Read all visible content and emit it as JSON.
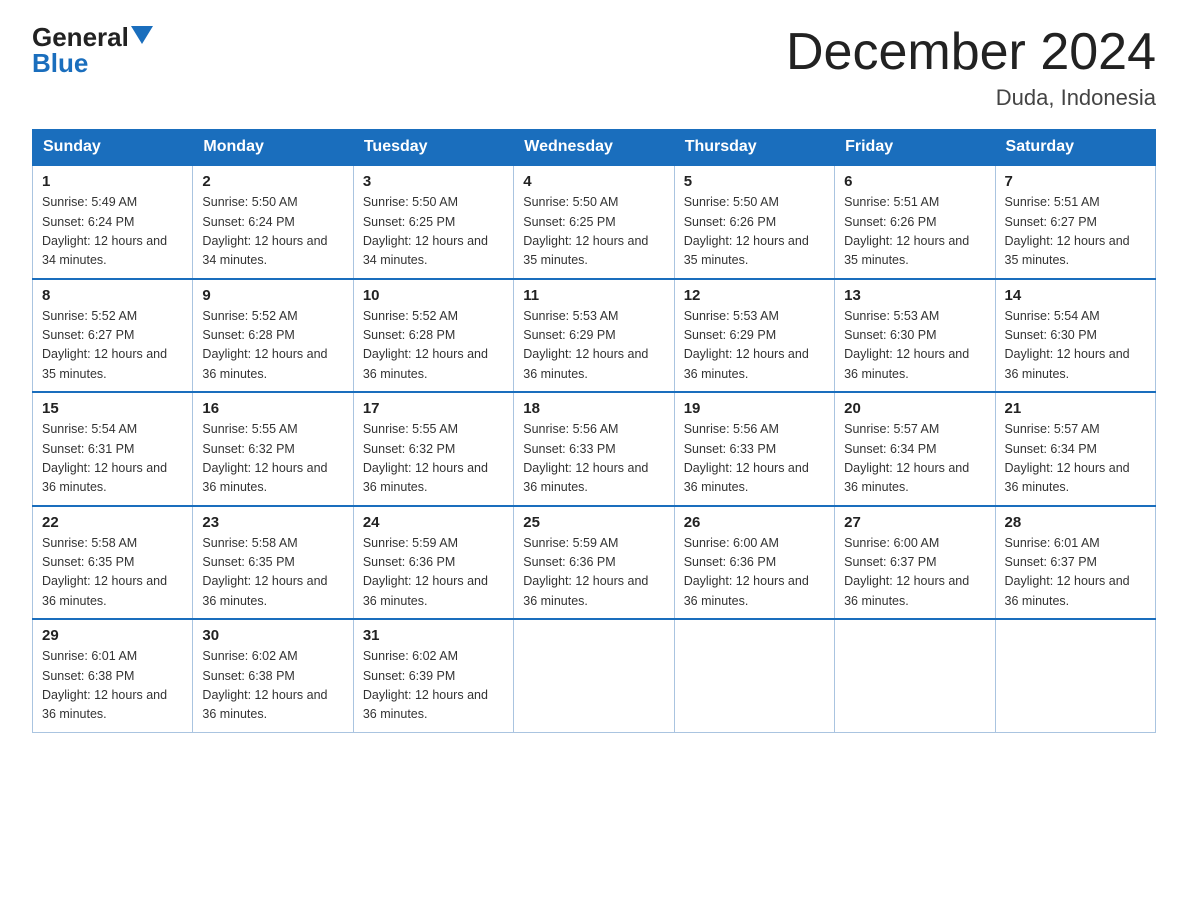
{
  "logo": {
    "general": "General",
    "blue": "Blue",
    "triangle": "▼"
  },
  "title": "December 2024",
  "subtitle": "Duda, Indonesia",
  "days_of_week": [
    "Sunday",
    "Monday",
    "Tuesday",
    "Wednesday",
    "Thursday",
    "Friday",
    "Saturday"
  ],
  "weeks": [
    [
      {
        "day": "1",
        "sunrise": "5:49 AM",
        "sunset": "6:24 PM",
        "daylight": "12 hours and 34 minutes."
      },
      {
        "day": "2",
        "sunrise": "5:50 AM",
        "sunset": "6:24 PM",
        "daylight": "12 hours and 34 minutes."
      },
      {
        "day": "3",
        "sunrise": "5:50 AM",
        "sunset": "6:25 PM",
        "daylight": "12 hours and 34 minutes."
      },
      {
        "day": "4",
        "sunrise": "5:50 AM",
        "sunset": "6:25 PM",
        "daylight": "12 hours and 35 minutes."
      },
      {
        "day": "5",
        "sunrise": "5:50 AM",
        "sunset": "6:26 PM",
        "daylight": "12 hours and 35 minutes."
      },
      {
        "day": "6",
        "sunrise": "5:51 AM",
        "sunset": "6:26 PM",
        "daylight": "12 hours and 35 minutes."
      },
      {
        "day": "7",
        "sunrise": "5:51 AM",
        "sunset": "6:27 PM",
        "daylight": "12 hours and 35 minutes."
      }
    ],
    [
      {
        "day": "8",
        "sunrise": "5:52 AM",
        "sunset": "6:27 PM",
        "daylight": "12 hours and 35 minutes."
      },
      {
        "day": "9",
        "sunrise": "5:52 AM",
        "sunset": "6:28 PM",
        "daylight": "12 hours and 36 minutes."
      },
      {
        "day": "10",
        "sunrise": "5:52 AM",
        "sunset": "6:28 PM",
        "daylight": "12 hours and 36 minutes."
      },
      {
        "day": "11",
        "sunrise": "5:53 AM",
        "sunset": "6:29 PM",
        "daylight": "12 hours and 36 minutes."
      },
      {
        "day": "12",
        "sunrise": "5:53 AM",
        "sunset": "6:29 PM",
        "daylight": "12 hours and 36 minutes."
      },
      {
        "day": "13",
        "sunrise": "5:53 AM",
        "sunset": "6:30 PM",
        "daylight": "12 hours and 36 minutes."
      },
      {
        "day": "14",
        "sunrise": "5:54 AM",
        "sunset": "6:30 PM",
        "daylight": "12 hours and 36 minutes."
      }
    ],
    [
      {
        "day": "15",
        "sunrise": "5:54 AM",
        "sunset": "6:31 PM",
        "daylight": "12 hours and 36 minutes."
      },
      {
        "day": "16",
        "sunrise": "5:55 AM",
        "sunset": "6:32 PM",
        "daylight": "12 hours and 36 minutes."
      },
      {
        "day": "17",
        "sunrise": "5:55 AM",
        "sunset": "6:32 PM",
        "daylight": "12 hours and 36 minutes."
      },
      {
        "day": "18",
        "sunrise": "5:56 AM",
        "sunset": "6:33 PM",
        "daylight": "12 hours and 36 minutes."
      },
      {
        "day": "19",
        "sunrise": "5:56 AM",
        "sunset": "6:33 PM",
        "daylight": "12 hours and 36 minutes."
      },
      {
        "day": "20",
        "sunrise": "5:57 AM",
        "sunset": "6:34 PM",
        "daylight": "12 hours and 36 minutes."
      },
      {
        "day": "21",
        "sunrise": "5:57 AM",
        "sunset": "6:34 PM",
        "daylight": "12 hours and 36 minutes."
      }
    ],
    [
      {
        "day": "22",
        "sunrise": "5:58 AM",
        "sunset": "6:35 PM",
        "daylight": "12 hours and 36 minutes."
      },
      {
        "day": "23",
        "sunrise": "5:58 AM",
        "sunset": "6:35 PM",
        "daylight": "12 hours and 36 minutes."
      },
      {
        "day": "24",
        "sunrise": "5:59 AM",
        "sunset": "6:36 PM",
        "daylight": "12 hours and 36 minutes."
      },
      {
        "day": "25",
        "sunrise": "5:59 AM",
        "sunset": "6:36 PM",
        "daylight": "12 hours and 36 minutes."
      },
      {
        "day": "26",
        "sunrise": "6:00 AM",
        "sunset": "6:36 PM",
        "daylight": "12 hours and 36 minutes."
      },
      {
        "day": "27",
        "sunrise": "6:00 AM",
        "sunset": "6:37 PM",
        "daylight": "12 hours and 36 minutes."
      },
      {
        "day": "28",
        "sunrise": "6:01 AM",
        "sunset": "6:37 PM",
        "daylight": "12 hours and 36 minutes."
      }
    ],
    [
      {
        "day": "29",
        "sunrise": "6:01 AM",
        "sunset": "6:38 PM",
        "daylight": "12 hours and 36 minutes."
      },
      {
        "day": "30",
        "sunrise": "6:02 AM",
        "sunset": "6:38 PM",
        "daylight": "12 hours and 36 minutes."
      },
      {
        "day": "31",
        "sunrise": "6:02 AM",
        "sunset": "6:39 PM",
        "daylight": "12 hours and 36 minutes."
      },
      null,
      null,
      null,
      null
    ]
  ],
  "labels": {
    "sunrise": "Sunrise:",
    "sunset": "Sunset:",
    "daylight": "Daylight:"
  }
}
